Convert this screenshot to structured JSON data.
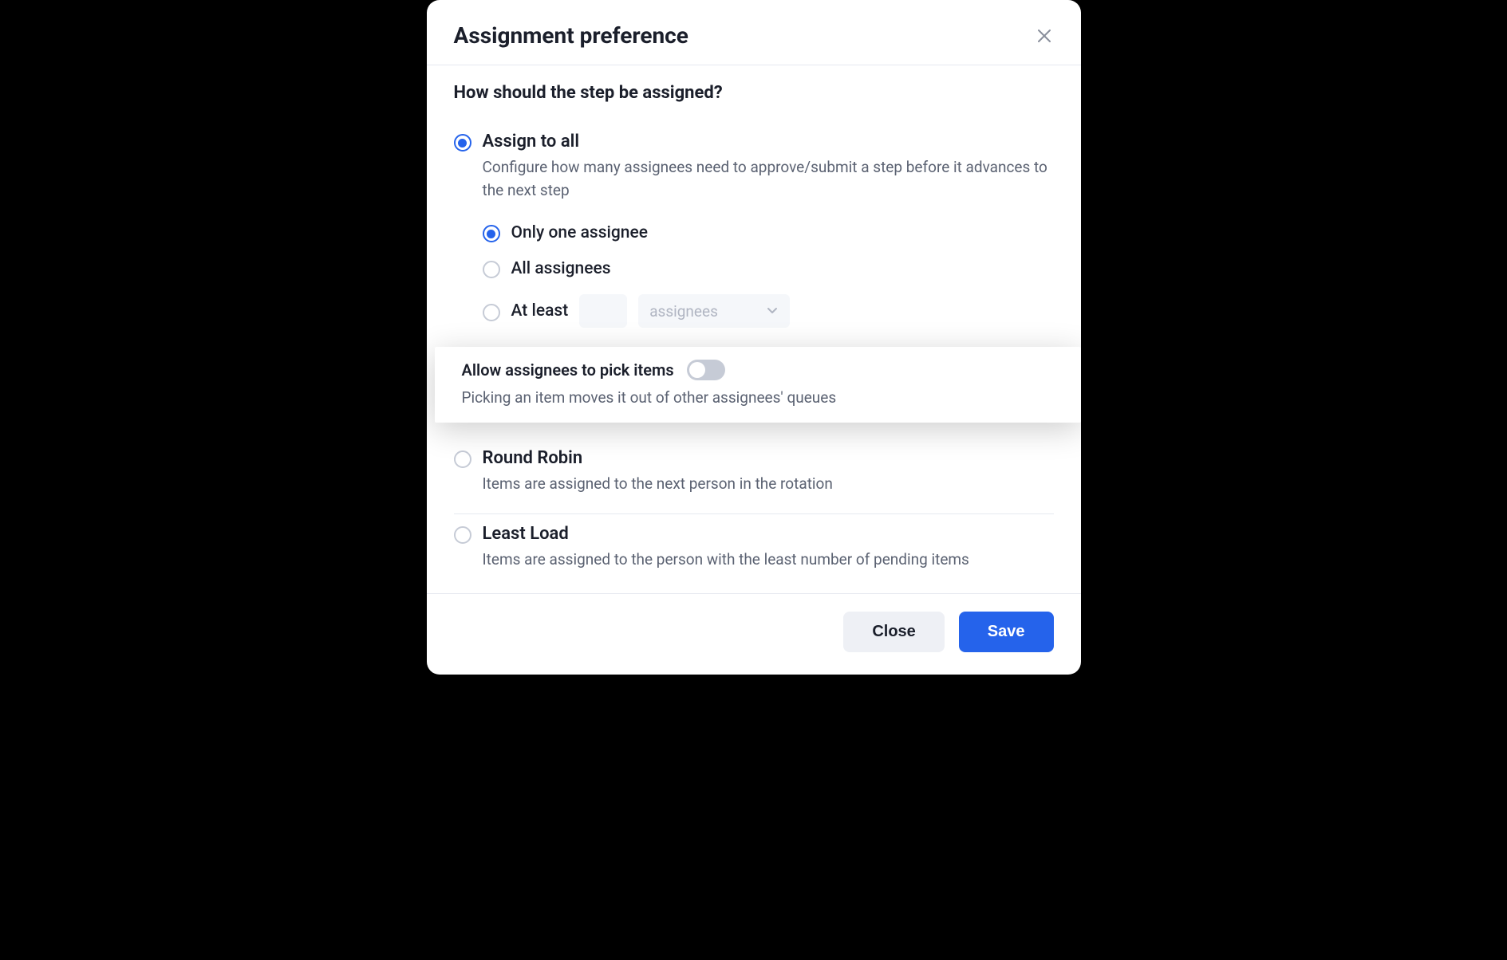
{
  "modal": {
    "title": "Assignment preference",
    "section_heading": "How should the step be assigned?",
    "options": {
      "assign_all": {
        "title": "Assign to all",
        "description": "Configure how many assignees need to approve/submit a step before it advances to the next step",
        "sub_options": {
          "only_one": "Only one assignee",
          "all": "All assignees",
          "at_least": "At least",
          "dropdown_label": "assignees"
        },
        "allow_pick": {
          "label": "Allow assignees to pick items",
          "description": "Picking an item moves it out of other assignees' queues"
        }
      },
      "round_robin": {
        "title": "Round Robin",
        "description": "Items are assigned to the next person in the rotation"
      },
      "least_load": {
        "title": "Least Load",
        "description": "Items are assigned to the person with the least number of pending items"
      }
    },
    "footer": {
      "close": "Close",
      "save": "Save"
    }
  }
}
